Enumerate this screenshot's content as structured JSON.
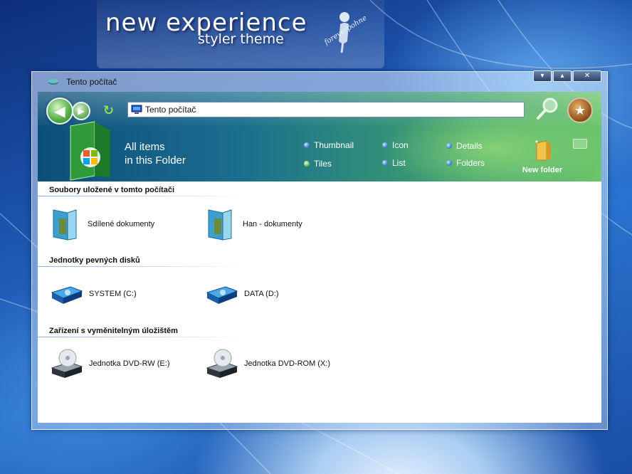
{
  "wallpaper": {
    "title": "new experience",
    "subtitle": "styler theme",
    "logo_text": "foreverpohne"
  },
  "window": {
    "title": "Tento počítač",
    "controls": {
      "minimize": "▾",
      "maximize": "▴",
      "close": "✕"
    }
  },
  "toolbar": {
    "address_value": "Tento počítač",
    "heading_line1": "All items",
    "heading_line2": "in this Folder",
    "views": [
      {
        "label": "Thumbnail"
      },
      {
        "label": "Icon"
      },
      {
        "label": "Details"
      },
      {
        "label": "Tiles"
      },
      {
        "label": "List"
      },
      {
        "label": "Folders"
      }
    ],
    "new_folder_label": "New folder"
  },
  "groups": [
    {
      "header": "Soubory uložené v tomto počítači",
      "items": [
        {
          "label": "Sdílené dokumenty",
          "icon": "shared-documents-folder-icon"
        },
        {
          "label": "Han - dokumenty",
          "icon": "user-documents-folder-icon"
        }
      ]
    },
    {
      "header": "Jednotky pevných disků",
      "items": [
        {
          "label": "SYSTEM (C:)",
          "icon": "hard-drive-icon"
        },
        {
          "label": "DATA (D:)",
          "icon": "hard-drive-icon"
        }
      ]
    },
    {
      "header": "Zařízení s vyměnitelným úložištěm",
      "items": [
        {
          "label": "Jednotka DVD-RW (E:)",
          "icon": "dvd-drive-icon"
        },
        {
          "label": "Jednotka DVD-ROM (X:)",
          "icon": "dvd-drive-icon"
        }
      ]
    }
  ],
  "colors": {
    "toolbar_left": "#0c4f7a",
    "toolbar_right": "#6cc56a",
    "group_line": "#8fb0d8"
  }
}
